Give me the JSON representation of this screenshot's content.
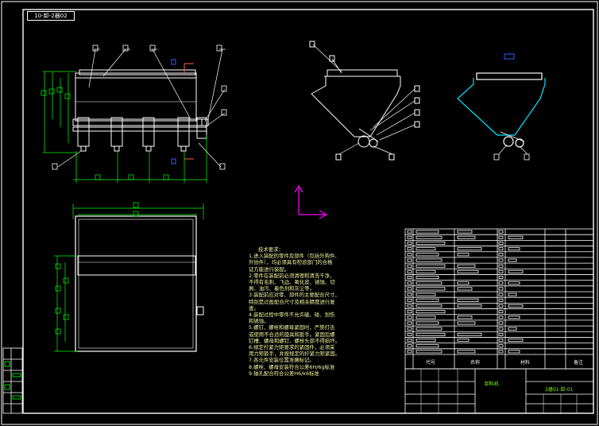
{
  "drawing": {
    "stamp": "10-卸-2器02",
    "code_box": "2器01-卸-01",
    "center_name": "卸料机"
  },
  "tech_notes": {
    "title": "技术要求：",
    "lines": [
      "1.进入装配的零件及部件（包括外购件、",
      "外协件），均必须具有检验部门的合格",
      "证方能进行装配。",
      "2.零件在装配前必须清理和清洗干净，",
      "不得有毛刺、飞边、氧化皮、锈蚀、切",
      "屑、油污、着色剂和灰尘等。",
      "3.装配前应对零、部件的主要配合尺寸，",
      "特别是过盈配合尺寸及相关精度进行复",
      "查。",
      "4.装配过程中零件不允许磕、碰、划伤",
      "和锈蚀。",
      "5.螺钉、螺栓和螺母紧固时，严禁打击",
      "或使用不合适的旋具和扳手。紧固后螺",
      "钉槽、螺母和螺钉、螺栓头部不得损坏。",
      "6.规定拧紧力矩要求的紧固件，必须采",
      "用力矩扳手，并按规定的拧紧力矩紧固。",
      "7.各元件安装位置准确标记。",
      "8.螺栓、螺母安装符合公差6H/6g标准",
      "9.轴孔配合符合公差H6/k6标准"
    ]
  },
  "bom_header": {
    "code": "代号",
    "name": "名称",
    "material": "材料",
    "note": "备注"
  },
  "colors": {
    "background": "#000000",
    "outline": "#ffffff",
    "dimension": "#00ff00",
    "leader": "#ffffff",
    "center": "#ff4040",
    "axis": "#ff00ff",
    "note_text": "#f0f0a0",
    "side_view": "#00ffff"
  }
}
